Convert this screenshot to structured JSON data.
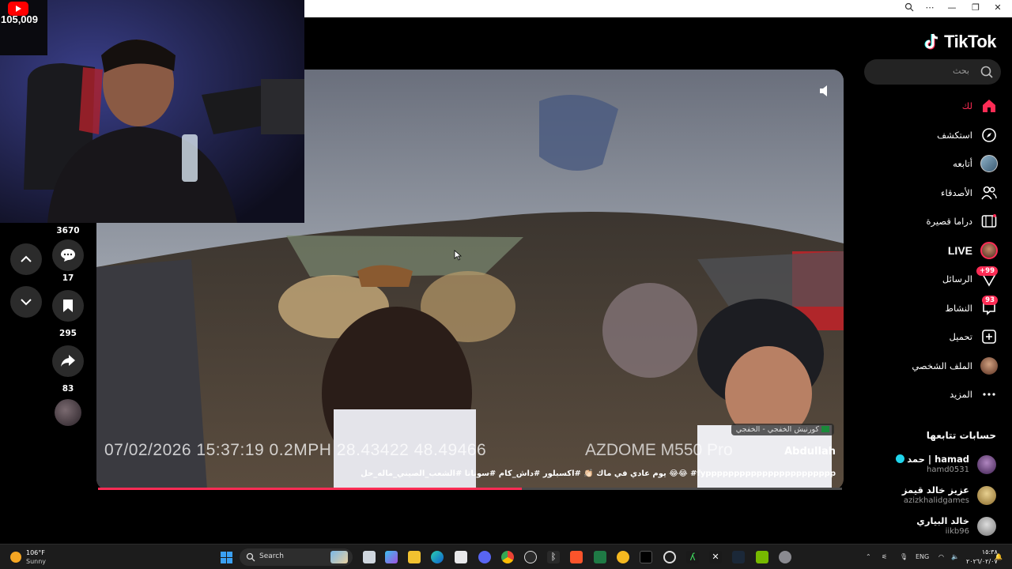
{
  "stream": {
    "view_count": "105,009"
  },
  "window": {
    "zoom_icon": "zoom-icon",
    "controls": [
      "minimize",
      "restore",
      "close"
    ]
  },
  "tiktok": {
    "logo_text": "TikTok",
    "search_placeholder": "بحث",
    "nav": [
      {
        "label": "لك",
        "icon": "home-icon",
        "active": true
      },
      {
        "label": "استكشف",
        "icon": "compass-icon"
      },
      {
        "label": "أتابعه",
        "icon": "following-avatar-icon"
      },
      {
        "label": "الأصدقاء",
        "icon": "friends-icon"
      },
      {
        "label": "دراما قصيرة",
        "icon": "drama-icon"
      },
      {
        "label": "LIVE",
        "icon": "live-avatar-icon"
      },
      {
        "label": "الرسائل",
        "icon": "messages-icon",
        "badge": "+99"
      },
      {
        "label": "النشاط",
        "icon": "activity-icon",
        "badge": "93"
      },
      {
        "label": "تحميل",
        "icon": "upload-icon"
      },
      {
        "label": "الملف الشخصي",
        "icon": "profile-avatar-icon"
      },
      {
        "label": "المزيد",
        "icon": "more-icon"
      }
    ],
    "following_title": "حسابات تتابعها",
    "following": [
      {
        "name": "حمد | hamad",
        "handle": "hamd0531",
        "verified": true
      },
      {
        "name": "عزيز خالد قيمز",
        "handle": "azizkhalidgames"
      },
      {
        "name": "خالد البياري",
        "handle": "iikb96"
      }
    ]
  },
  "video": {
    "overlay_timestamp": "07/02/2026  15:37:19  0.2MPH  28.43422  48.49466",
    "overlay_brand": "AZDOME  M550  Pro",
    "location": "كورنيش الخفجي - الخفجي",
    "author": "Abdullah",
    "caption": "يوم عادي في ماك 👏🏻 #اكسبلور #داش_كام #سوناتا #الشعب_الصيني_ماله_حل 😂😂 #fyppppppppppppppppppppppp",
    "progress": 0.57
  },
  "actions": {
    "top_count": "3670",
    "comments": "17",
    "saves": "295",
    "shares": "83"
  },
  "taskbar": {
    "weather_temp": "106°F",
    "weather_desc": "Sunny",
    "search_label": "Search",
    "language": "ENG",
    "time": "١٥:٣٨",
    "date": "٢٠٢٦/٠٢/٠٧"
  },
  "colors": {
    "accent": "#fe2c55",
    "sidebar_bg": "#000000",
    "taskbar_bg": "#1c1c1c"
  }
}
